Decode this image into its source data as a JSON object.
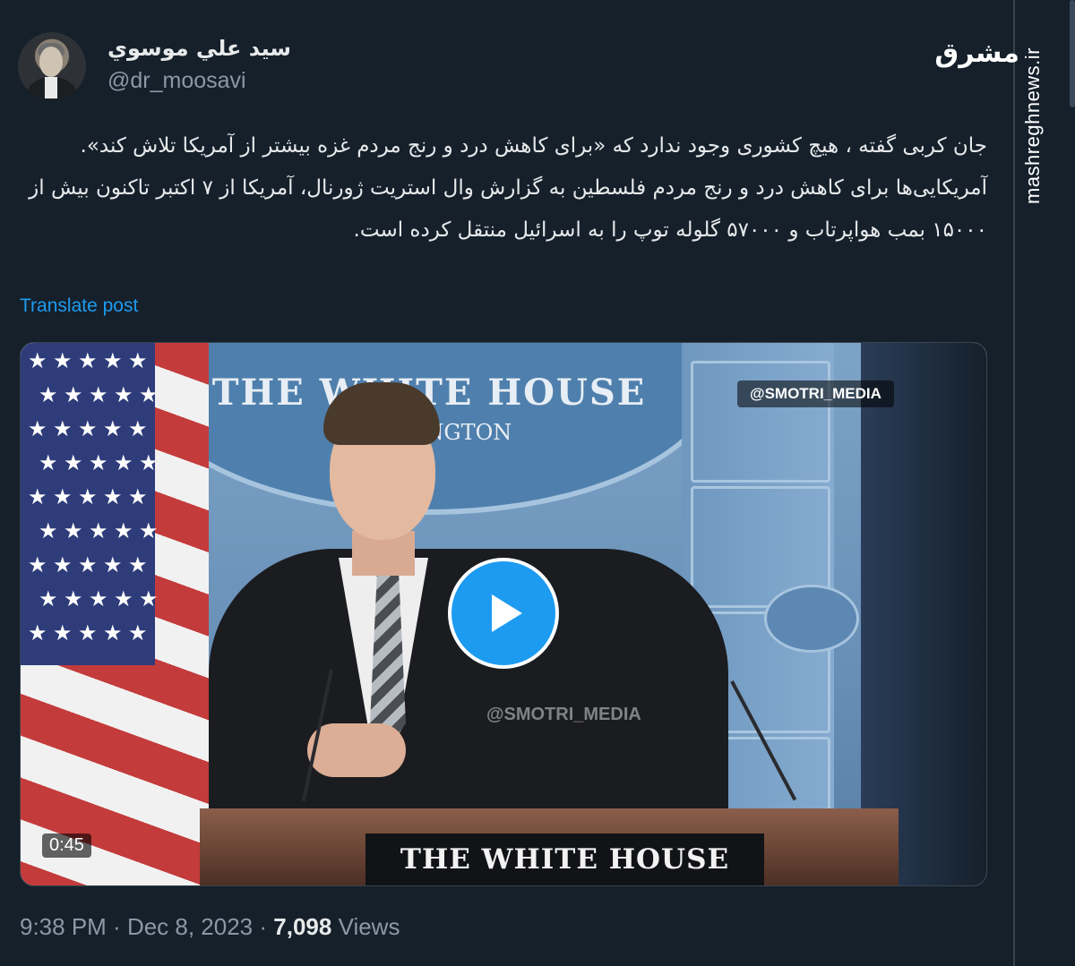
{
  "watermark": {
    "logo_text": "مشرق",
    "url": "mashreghnews.ir"
  },
  "author": {
    "name": "سيد علي موسوي",
    "handle": "@dr_moosavi"
  },
  "tweet": {
    "text": "جان کربی گفته ، هیچ کشوری وجود ندارد که «برای کاهش درد و رنج مردم غزه بیشتر از آمریکا تلاش کند».\nآمریکایی‌ها برای کاهش درد و رنج مردم فلسطین به گزارش وال استریت ژورنال، آمریکا از ۷ اکتبر تاکنون بیش از ۱۵۰۰۰ بمب هواپرتاب و ۵۷۰۰۰ گلوله توپ را به اسرائیل منتقل کرده است.",
    "translate_label": "Translate post"
  },
  "media": {
    "seal_text": "THE WHITE HOUSE",
    "seal_subtext": "WASHINGTON",
    "podium_sign": "THE WHITE HOUSE",
    "watermark_top": "@SMOTRI_MEDIA",
    "watermark_mid": "@SMOTRI_MEDIA",
    "duration": "0:45",
    "play_icon": "play-icon"
  },
  "meta": {
    "time": "9:38 PM",
    "separator": " · ",
    "date": "Dec 8, 2023",
    "views_count": "7,098",
    "views_label": "Views"
  },
  "colors": {
    "background": "#15202b",
    "accent": "#1d9bf0",
    "muted": "#8b98a5",
    "text": "#e7e9ea"
  }
}
